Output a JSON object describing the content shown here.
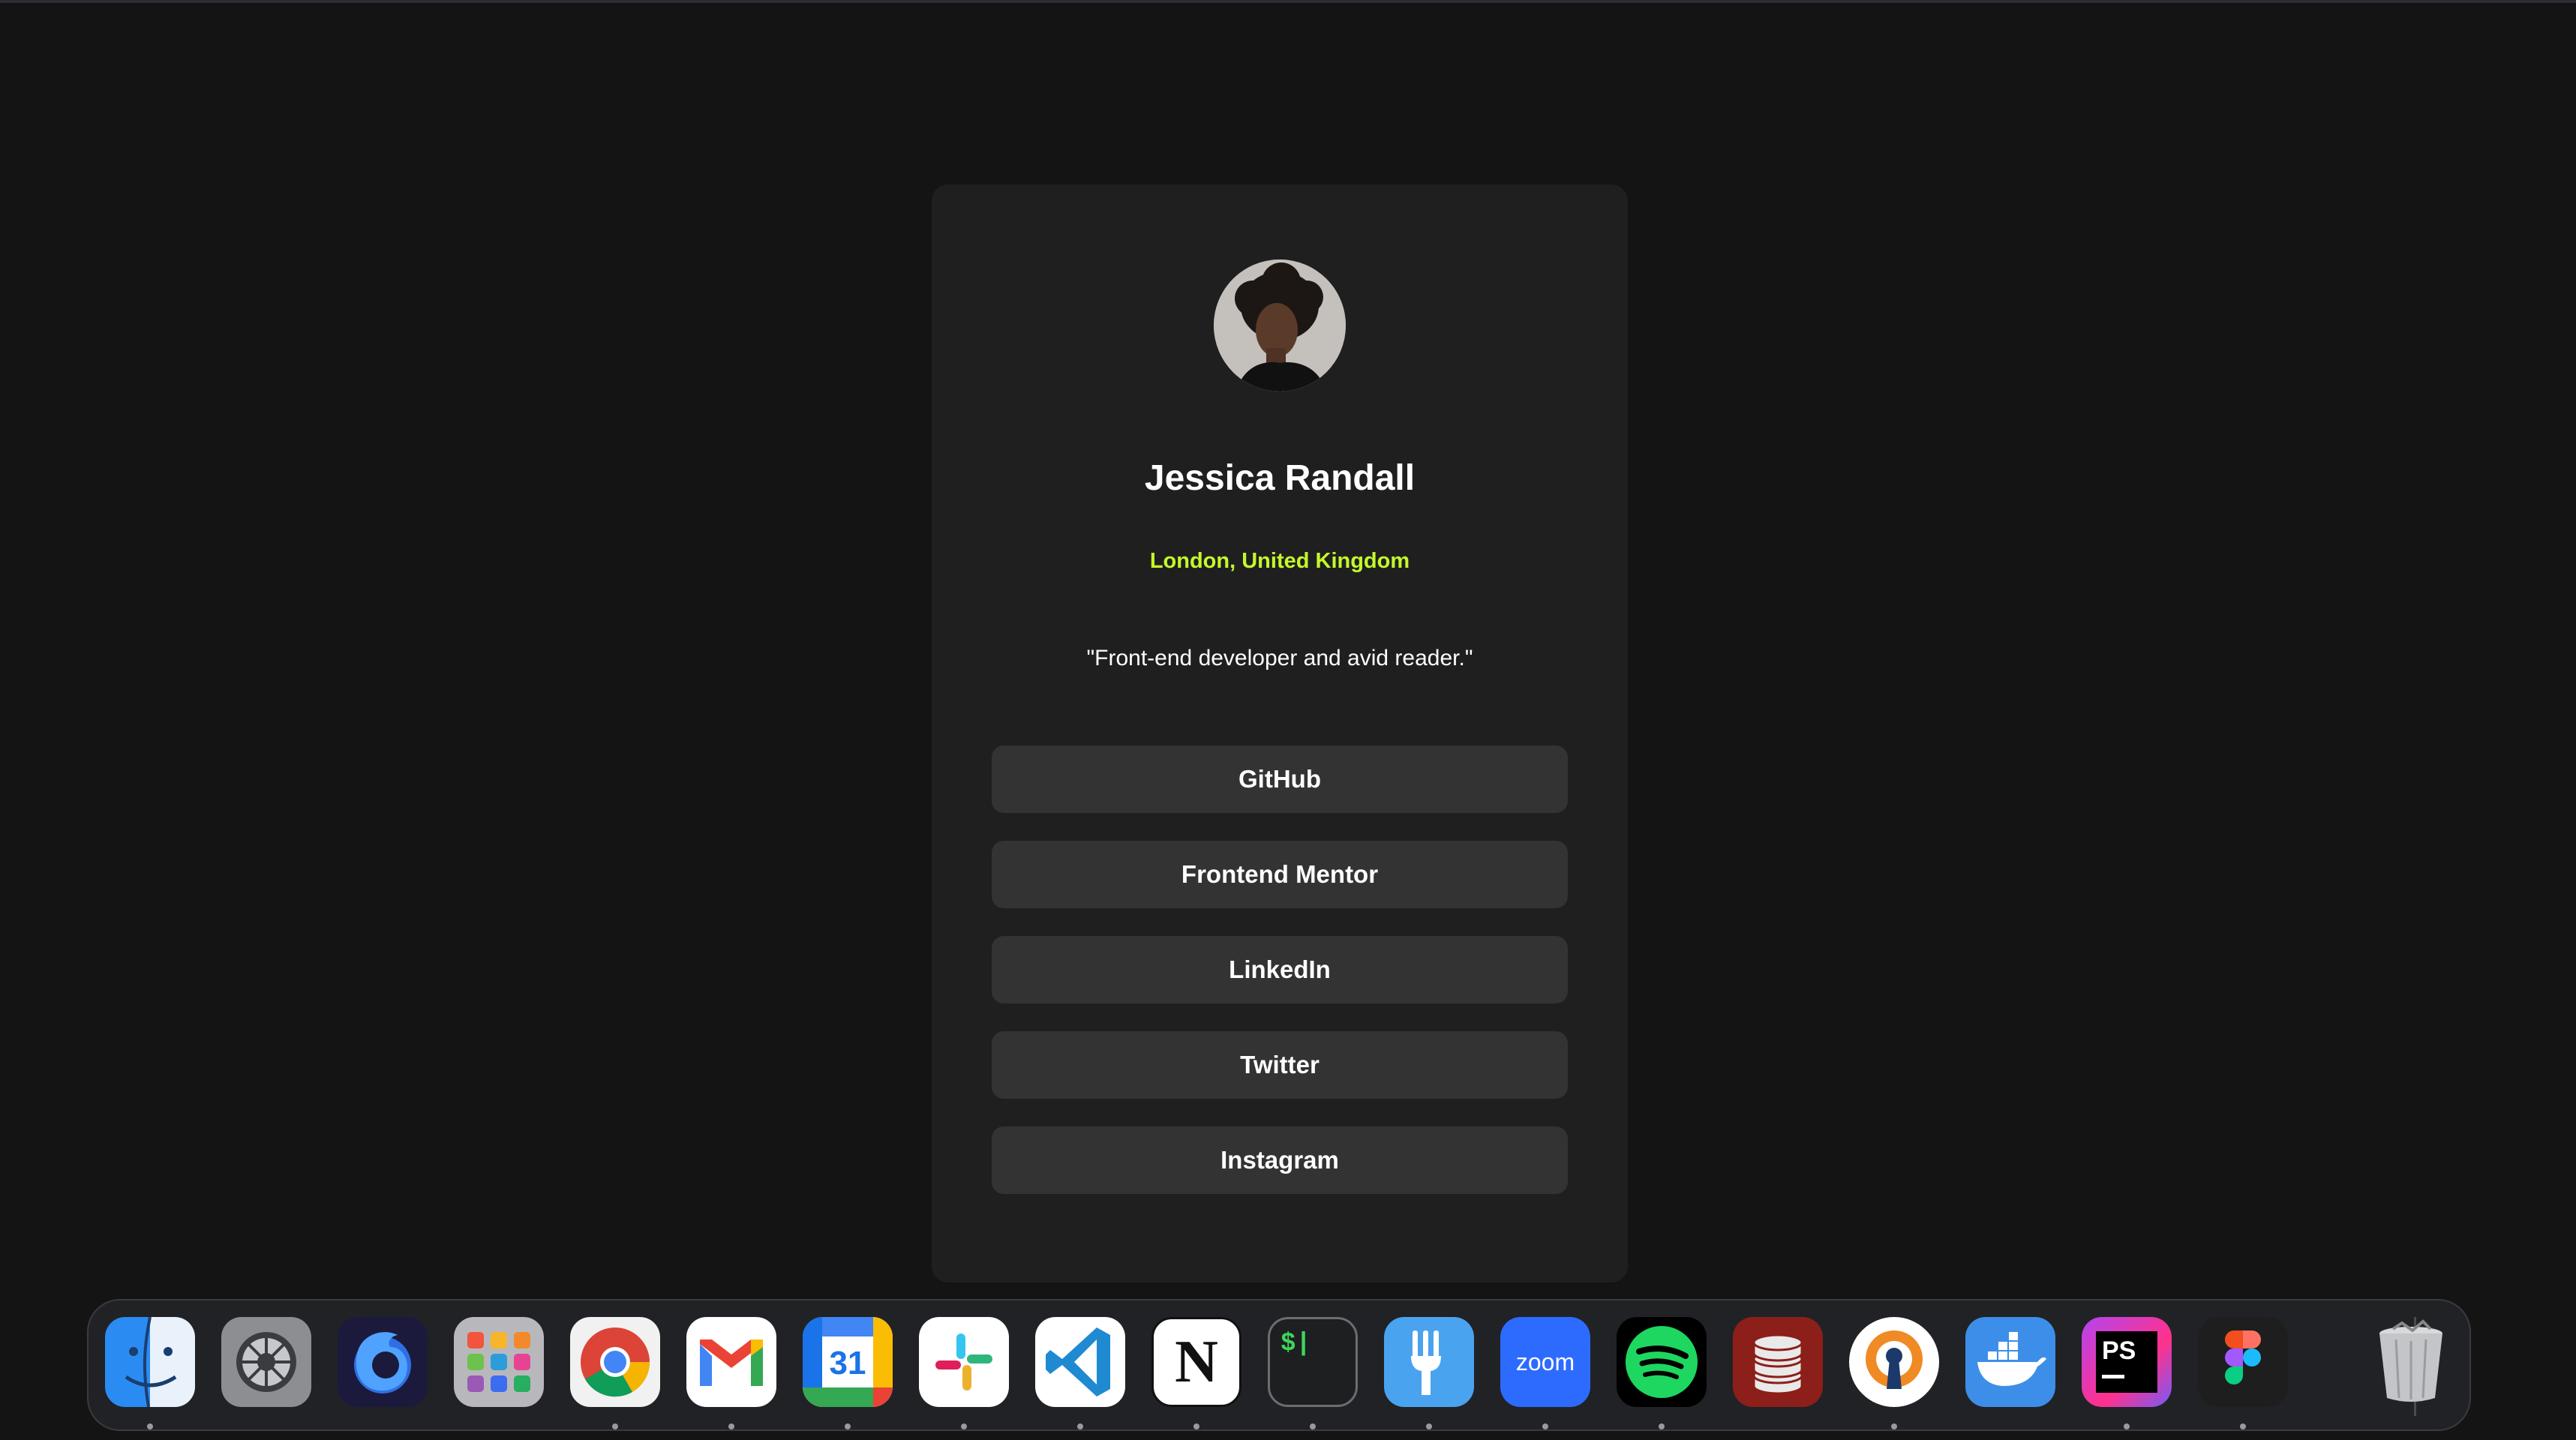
{
  "profile": {
    "name": "Jessica Randall",
    "location": "London, United Kingdom",
    "bio": "\"Front-end developer and avid reader.\"",
    "links": [
      "GitHub",
      "Frontend Mentor",
      "LinkedIn",
      "Twitter",
      "Instagram"
    ]
  },
  "colors": {
    "page_background": "#141414",
    "card_background": "#1f1f1f",
    "button_background": "#333333",
    "accent": "#c4f82a",
    "text": "#ffffff"
  },
  "dock": {
    "apps": [
      {
        "name": "Finder",
        "icon": "finder-icon",
        "running": true
      },
      {
        "name": "System Settings",
        "icon": "settings-gear-icon",
        "running": false
      },
      {
        "name": "Firefox Developer Edition",
        "icon": "firefox-icon",
        "running": false
      },
      {
        "name": "Launchpad",
        "icon": "launchpad-grid-icon",
        "running": false
      },
      {
        "name": "Google Chrome",
        "icon": "chrome-icon",
        "running": true
      },
      {
        "name": "Gmail",
        "icon": "gmail-icon",
        "running": true
      },
      {
        "name": "Google Calendar",
        "icon": "calendar-icon",
        "running": true,
        "text": "31"
      },
      {
        "name": "Slack",
        "icon": "slack-icon",
        "running": true
      },
      {
        "name": "Visual Studio Code",
        "icon": "vscode-icon",
        "running": true
      },
      {
        "name": "Notion",
        "icon": "notion-icon",
        "running": true,
        "text": "N"
      },
      {
        "name": "Terminal",
        "icon": "terminal-icon",
        "running": true,
        "text": "$|"
      },
      {
        "name": "Fork",
        "icon": "fork-icon",
        "running": true
      },
      {
        "name": "Zoom",
        "icon": "zoom-icon",
        "running": true,
        "text": "zoom"
      },
      {
        "name": "Spotify",
        "icon": "spotify-icon",
        "running": true
      },
      {
        "name": "Database",
        "icon": "database-icon",
        "running": false
      },
      {
        "name": "OpenVPN",
        "icon": "vpn-keyhole-icon",
        "running": true
      },
      {
        "name": "Docker",
        "icon": "docker-whale-icon",
        "running": false
      },
      {
        "name": "PhpStorm",
        "icon": "phpstorm-icon",
        "running": true,
        "text": "PS"
      },
      {
        "name": "Figma",
        "icon": "figma-icon",
        "running": true
      },
      {
        "name": "Trash",
        "icon": "trash-icon",
        "running": false
      }
    ]
  }
}
